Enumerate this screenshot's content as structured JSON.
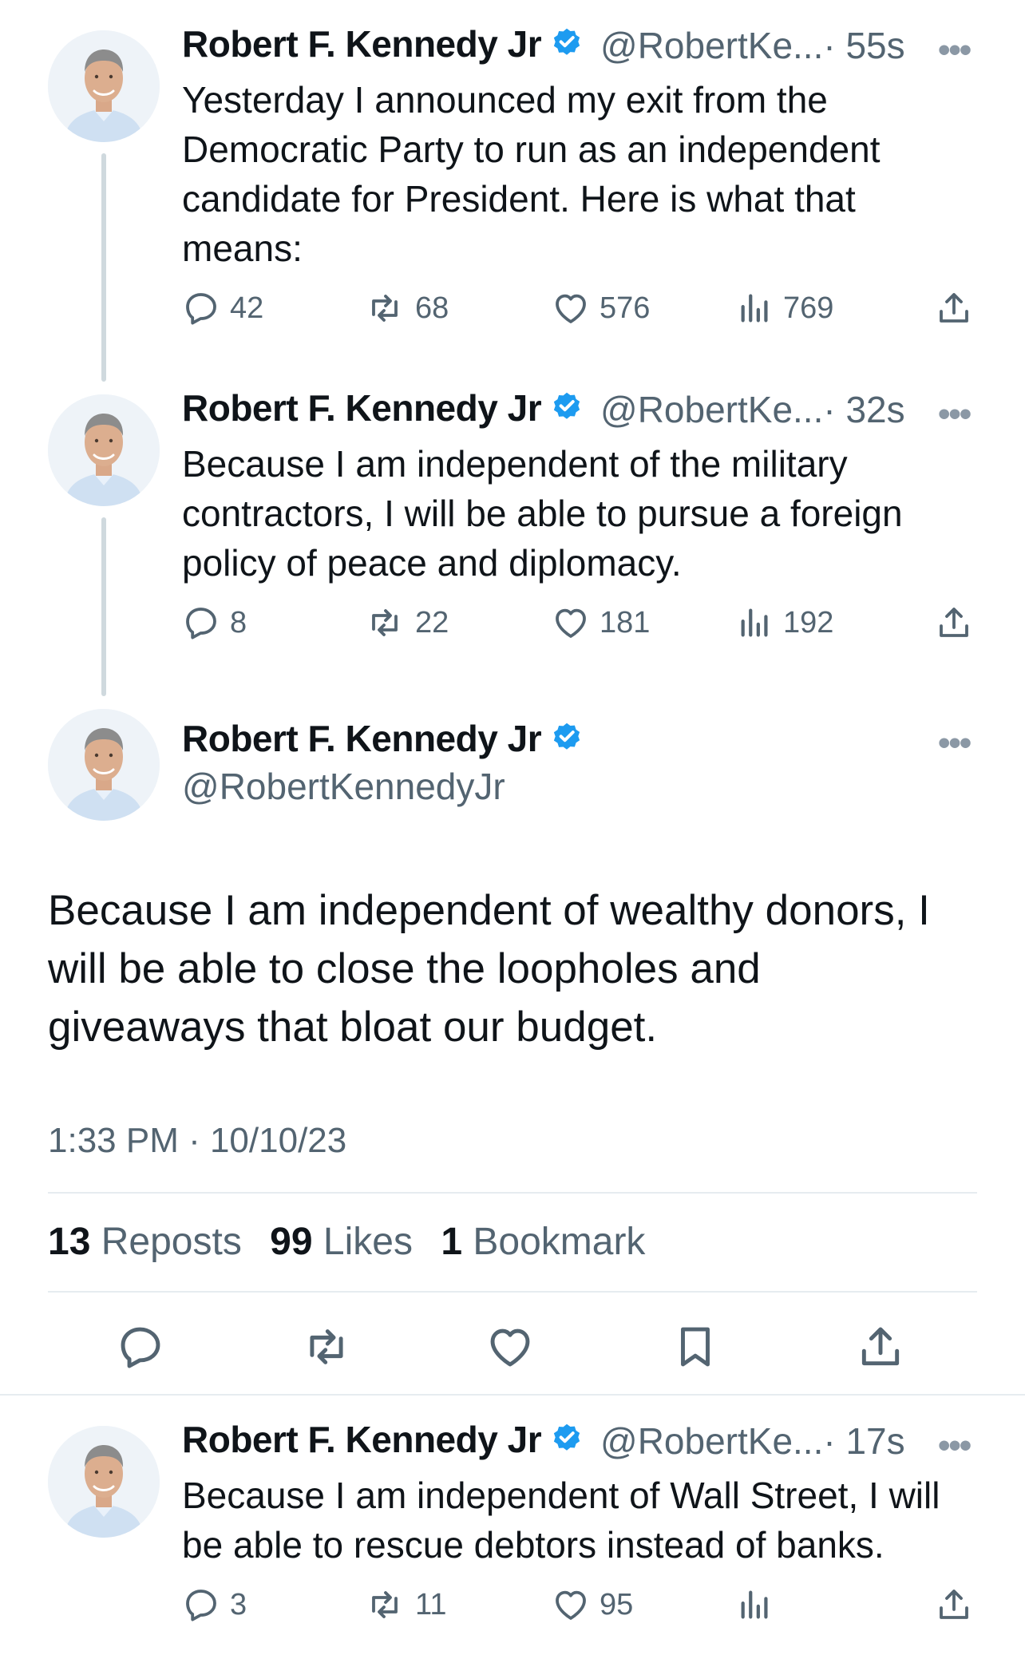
{
  "colors": {
    "verified": "#1d9bf0",
    "secondary": "#536471",
    "line": "#cfd9de"
  },
  "tweets": [
    {
      "name": "Robert F. Kennedy Jr",
      "handle": "@RobertKe...",
      "time": "· 55s",
      "text": "Yesterday I announced my exit from the\nDemocratic Party to run as an independent\ncandidate for President. Here is what that\nmeans:",
      "replies": "42",
      "reposts": "68",
      "likes": "576",
      "views": "769"
    },
    {
      "name": "Robert F. Kennedy Jr",
      "handle": "@RobertKe...",
      "time": "· 32s",
      "text": "Because I am independent of the military\ncontractors, I will be able to pursue a foreign\npolicy of peace and diplomacy.",
      "replies": "8",
      "reposts": "22",
      "likes": "181",
      "views": "192"
    },
    {
      "name": "Robert F. Kennedy Jr",
      "handle": "@RobertKe...",
      "time": "· 17s",
      "text": "Because I am independent of Wall Street, I will\nbe able to rescue debtors instead of banks.",
      "replies": "3",
      "reposts": "11",
      "likes": "95",
      "views": ""
    }
  ],
  "main": {
    "name": "Robert F. Kennedy Jr",
    "handle": "@RobertKennedyJr",
    "text": "Because I am independent of wealthy donors, I\nwill be able to close the loopholes and\ngiveaways that bloat our budget.",
    "timestamp": "1:33 PM · 10/10/23",
    "reposts_count": "13",
    "reposts_label": "Reposts",
    "likes_count": "99",
    "likes_label": "Likes",
    "bookmarks_count": "1",
    "bookmarks_label": "Bookmark"
  },
  "more_glyph": "•••"
}
